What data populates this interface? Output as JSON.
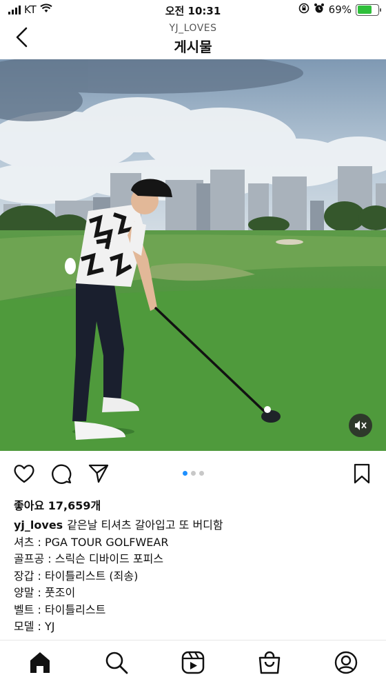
{
  "status_bar": {
    "carrier": "KT",
    "time": "오전 10:31",
    "battery": "69%",
    "battery_level": 0.69,
    "icons": [
      "signal-icon",
      "wifi-icon",
      "lock-rotation-icon",
      "alarm-icon",
      "battery-charging-icon"
    ]
  },
  "header": {
    "username": "YJ_LOVES",
    "title": "게시물"
  },
  "media": {
    "description_icons": [
      "mute-icon"
    ],
    "carousel": {
      "count": 3,
      "active_index": 0
    }
  },
  "actions": {
    "icons": [
      "heart-icon",
      "comment-icon",
      "share-icon",
      "bookmark-icon"
    ]
  },
  "post": {
    "likes": "좋아요 17,659개",
    "caption_user": "yj_loves",
    "caption_text": "같은날 티셔츠 갈아입고 또 버디함",
    "lines": [
      "셔츠 : PGA TOUR GOLFWEAR",
      "골프공 : 스릭슨 디바이드 포피스",
      "장갑 : 타이틀리스트 (죄송)",
      "양말 : 풋조이",
      "벨트 : 타이틀리스트",
      "모델 : YJ"
    ]
  },
  "bottom_nav": {
    "items": [
      "home-icon",
      "search-icon",
      "reels-icon",
      "shop-icon",
      "profile-icon"
    ]
  },
  "colors": {
    "accent": "#1e90ff",
    "battery": "#2fbf3b",
    "grass": "#4f9a3c",
    "sky": "#9fb6cc"
  }
}
